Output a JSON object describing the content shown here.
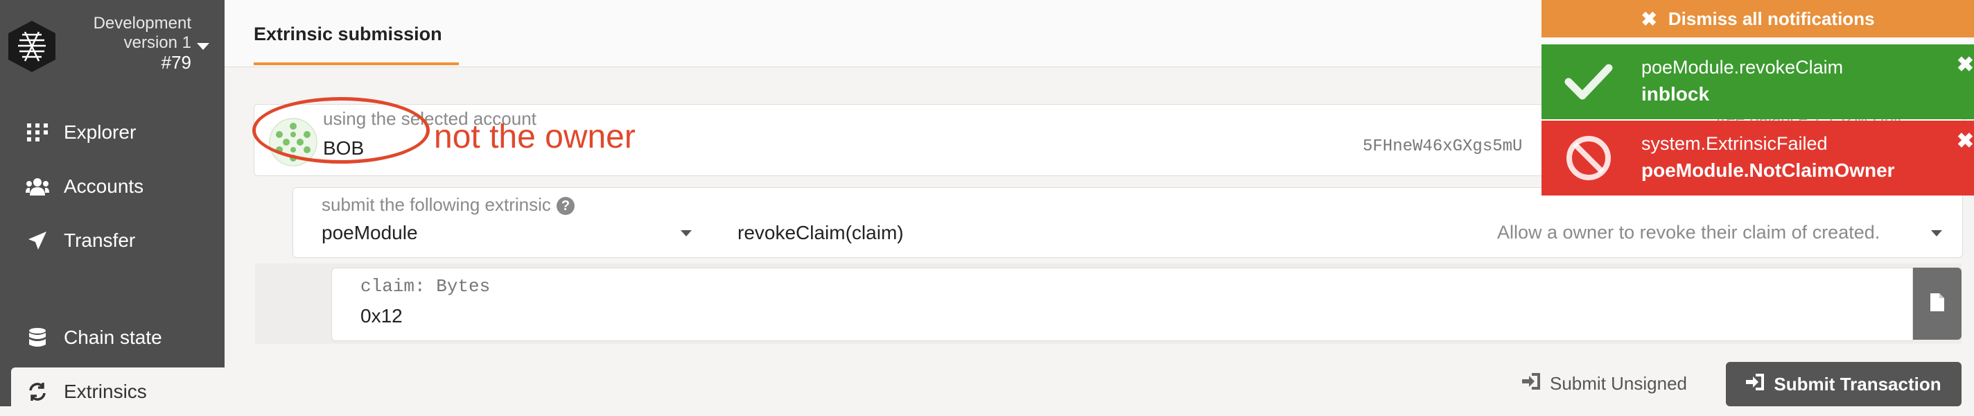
{
  "sidebar": {
    "chain_name": "Development",
    "chain_version": "version 1",
    "block": "#79",
    "items": [
      {
        "label": "Explorer",
        "icon": "explorer-icon"
      },
      {
        "label": "Accounts",
        "icon": "users-icon"
      },
      {
        "label": "Transfer",
        "icon": "paper-plane-icon"
      },
      {
        "label": "Chain state",
        "icon": "database-icon"
      },
      {
        "label": "Extrinsics",
        "icon": "sync-icon"
      }
    ]
  },
  "tabs": [
    {
      "label": "Extrinsic submission"
    }
  ],
  "account": {
    "label": "using the selected account",
    "value": "BOB",
    "address": "5FHneW46xGXgs5mU",
    "balance_label": "free balance 1.152M Unit"
  },
  "extrinsic": {
    "label": "submit the following extrinsic",
    "help": "?",
    "module": "poeModule",
    "call": "revokeClaim(claim)",
    "description": "Allow a owner to revoke their claim of created."
  },
  "param": {
    "label": "claim: Bytes",
    "value": "0x12"
  },
  "buttons": {
    "unsigned": "Submit Unsigned",
    "submit": "Submit Transaction"
  },
  "annotation": "not the owner",
  "notifications": {
    "dismiss": "Dismiss all notifications",
    "items": [
      {
        "title": "poeModule.revokeClaim",
        "status": "inblock",
        "type": "success"
      },
      {
        "title": "system.ExtrinsicFailed",
        "status": "poeModule.NotClaimOwner",
        "type": "error"
      }
    ]
  },
  "colors": {
    "sidebar": "#4e4e4e",
    "accent": "#f19135",
    "success": "#3c9a2f",
    "error": "#e2372f",
    "annotation": "#e0482b",
    "dismiss": "#e8903b"
  }
}
